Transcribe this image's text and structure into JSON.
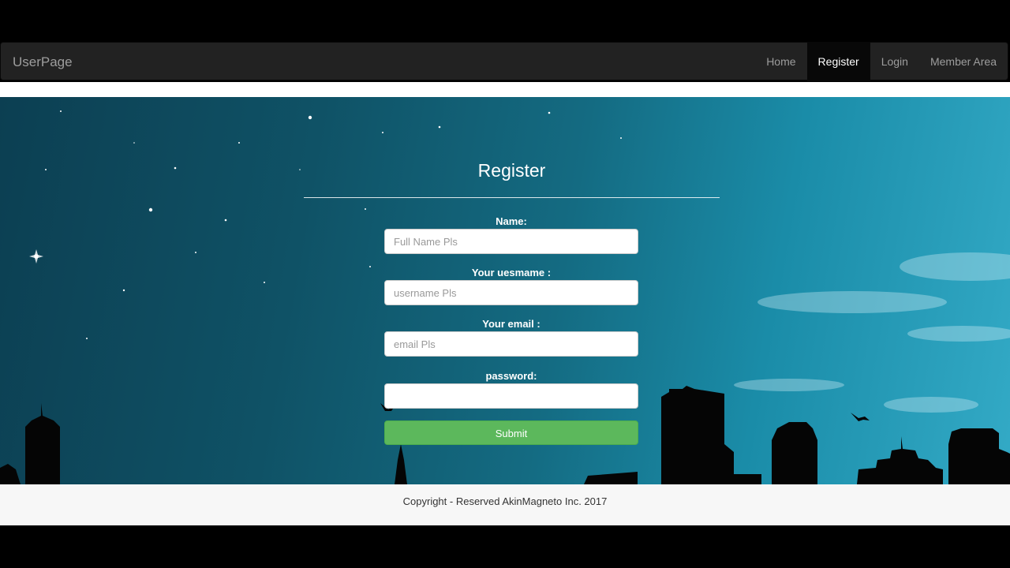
{
  "navbar": {
    "brand": "UserPage",
    "items": [
      {
        "label": "Home",
        "active": false
      },
      {
        "label": "Register",
        "active": true
      },
      {
        "label": "Login",
        "active": false
      },
      {
        "label": "Member Area",
        "active": false
      }
    ]
  },
  "form": {
    "title": "Register",
    "fields": [
      {
        "label": "Name:",
        "placeholder": "Full Name Pls",
        "value": ""
      },
      {
        "label": "Your uesmame :",
        "placeholder": "username Pls",
        "value": ""
      },
      {
        "label": "Your email :",
        "placeholder": "email Pls",
        "value": ""
      },
      {
        "label": "password:",
        "placeholder": "",
        "value": ""
      }
    ],
    "submit_label": "Submit"
  },
  "footer": {
    "text": "Copyright - Reserved AkinMagneto Inc. 2017"
  },
  "colors": {
    "navbar_bg": "#222222",
    "accent_green": "#5cb85c",
    "hero_sky": "#146b82"
  }
}
